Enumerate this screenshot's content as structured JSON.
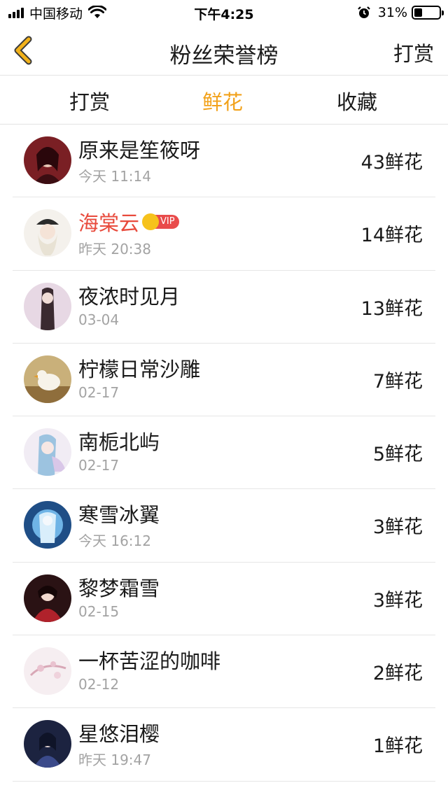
{
  "status_bar": {
    "carrier": "中国移动",
    "time": "下午4:25",
    "battery": "31%",
    "battery_level": 0.31,
    "icons": [
      "signal-icon",
      "wifi-icon",
      "alarm-icon",
      "battery-icon"
    ]
  },
  "nav": {
    "back_icon": "chevron-left-icon",
    "title": "粉丝荣誉榜",
    "right_label": "打赏"
  },
  "tabs": [
    {
      "label": "打赏",
      "active": false
    },
    {
      "label": "鲜花",
      "active": true
    },
    {
      "label": "收藏",
      "active": false
    }
  ],
  "colors": {
    "accent": "#f2a21b",
    "vip_name": "#e84a3c",
    "vip_badge": "#e94b4b",
    "crown": "#f6c21c",
    "secondary_text": "#a3a3a3",
    "back_icon": "#f2b21b"
  },
  "fans": [
    {
      "name": "原来是笙筱呀",
      "time": "今天 11:14",
      "count": "43鲜花",
      "vip": false
    },
    {
      "name": "海棠云",
      "time": "昨天 20:38",
      "count": "14鲜花",
      "vip": true,
      "vip_label": "VIP"
    },
    {
      "name": "夜浓时见月",
      "time": "03-04",
      "count": "13鲜花",
      "vip": false
    },
    {
      "name": "柠檬日常沙雕",
      "time": "02-17",
      "count": "7鲜花",
      "vip": false
    },
    {
      "name": "南栀北屿",
      "time": "02-17",
      "count": "5鲜花",
      "vip": false
    },
    {
      "name": "寒雪冰翼",
      "time": "今天 16:12",
      "count": "3鲜花",
      "vip": false
    },
    {
      "name": "黎梦霜雪",
      "time": "02-15",
      "count": "3鲜花",
      "vip": false
    },
    {
      "name": "一杯苦涩的咖啡",
      "time": "02-12",
      "count": "2鲜花",
      "vip": false
    },
    {
      "name": "星悠泪樱",
      "time": "昨天 19:47",
      "count": "1鲜花",
      "vip": false
    }
  ]
}
